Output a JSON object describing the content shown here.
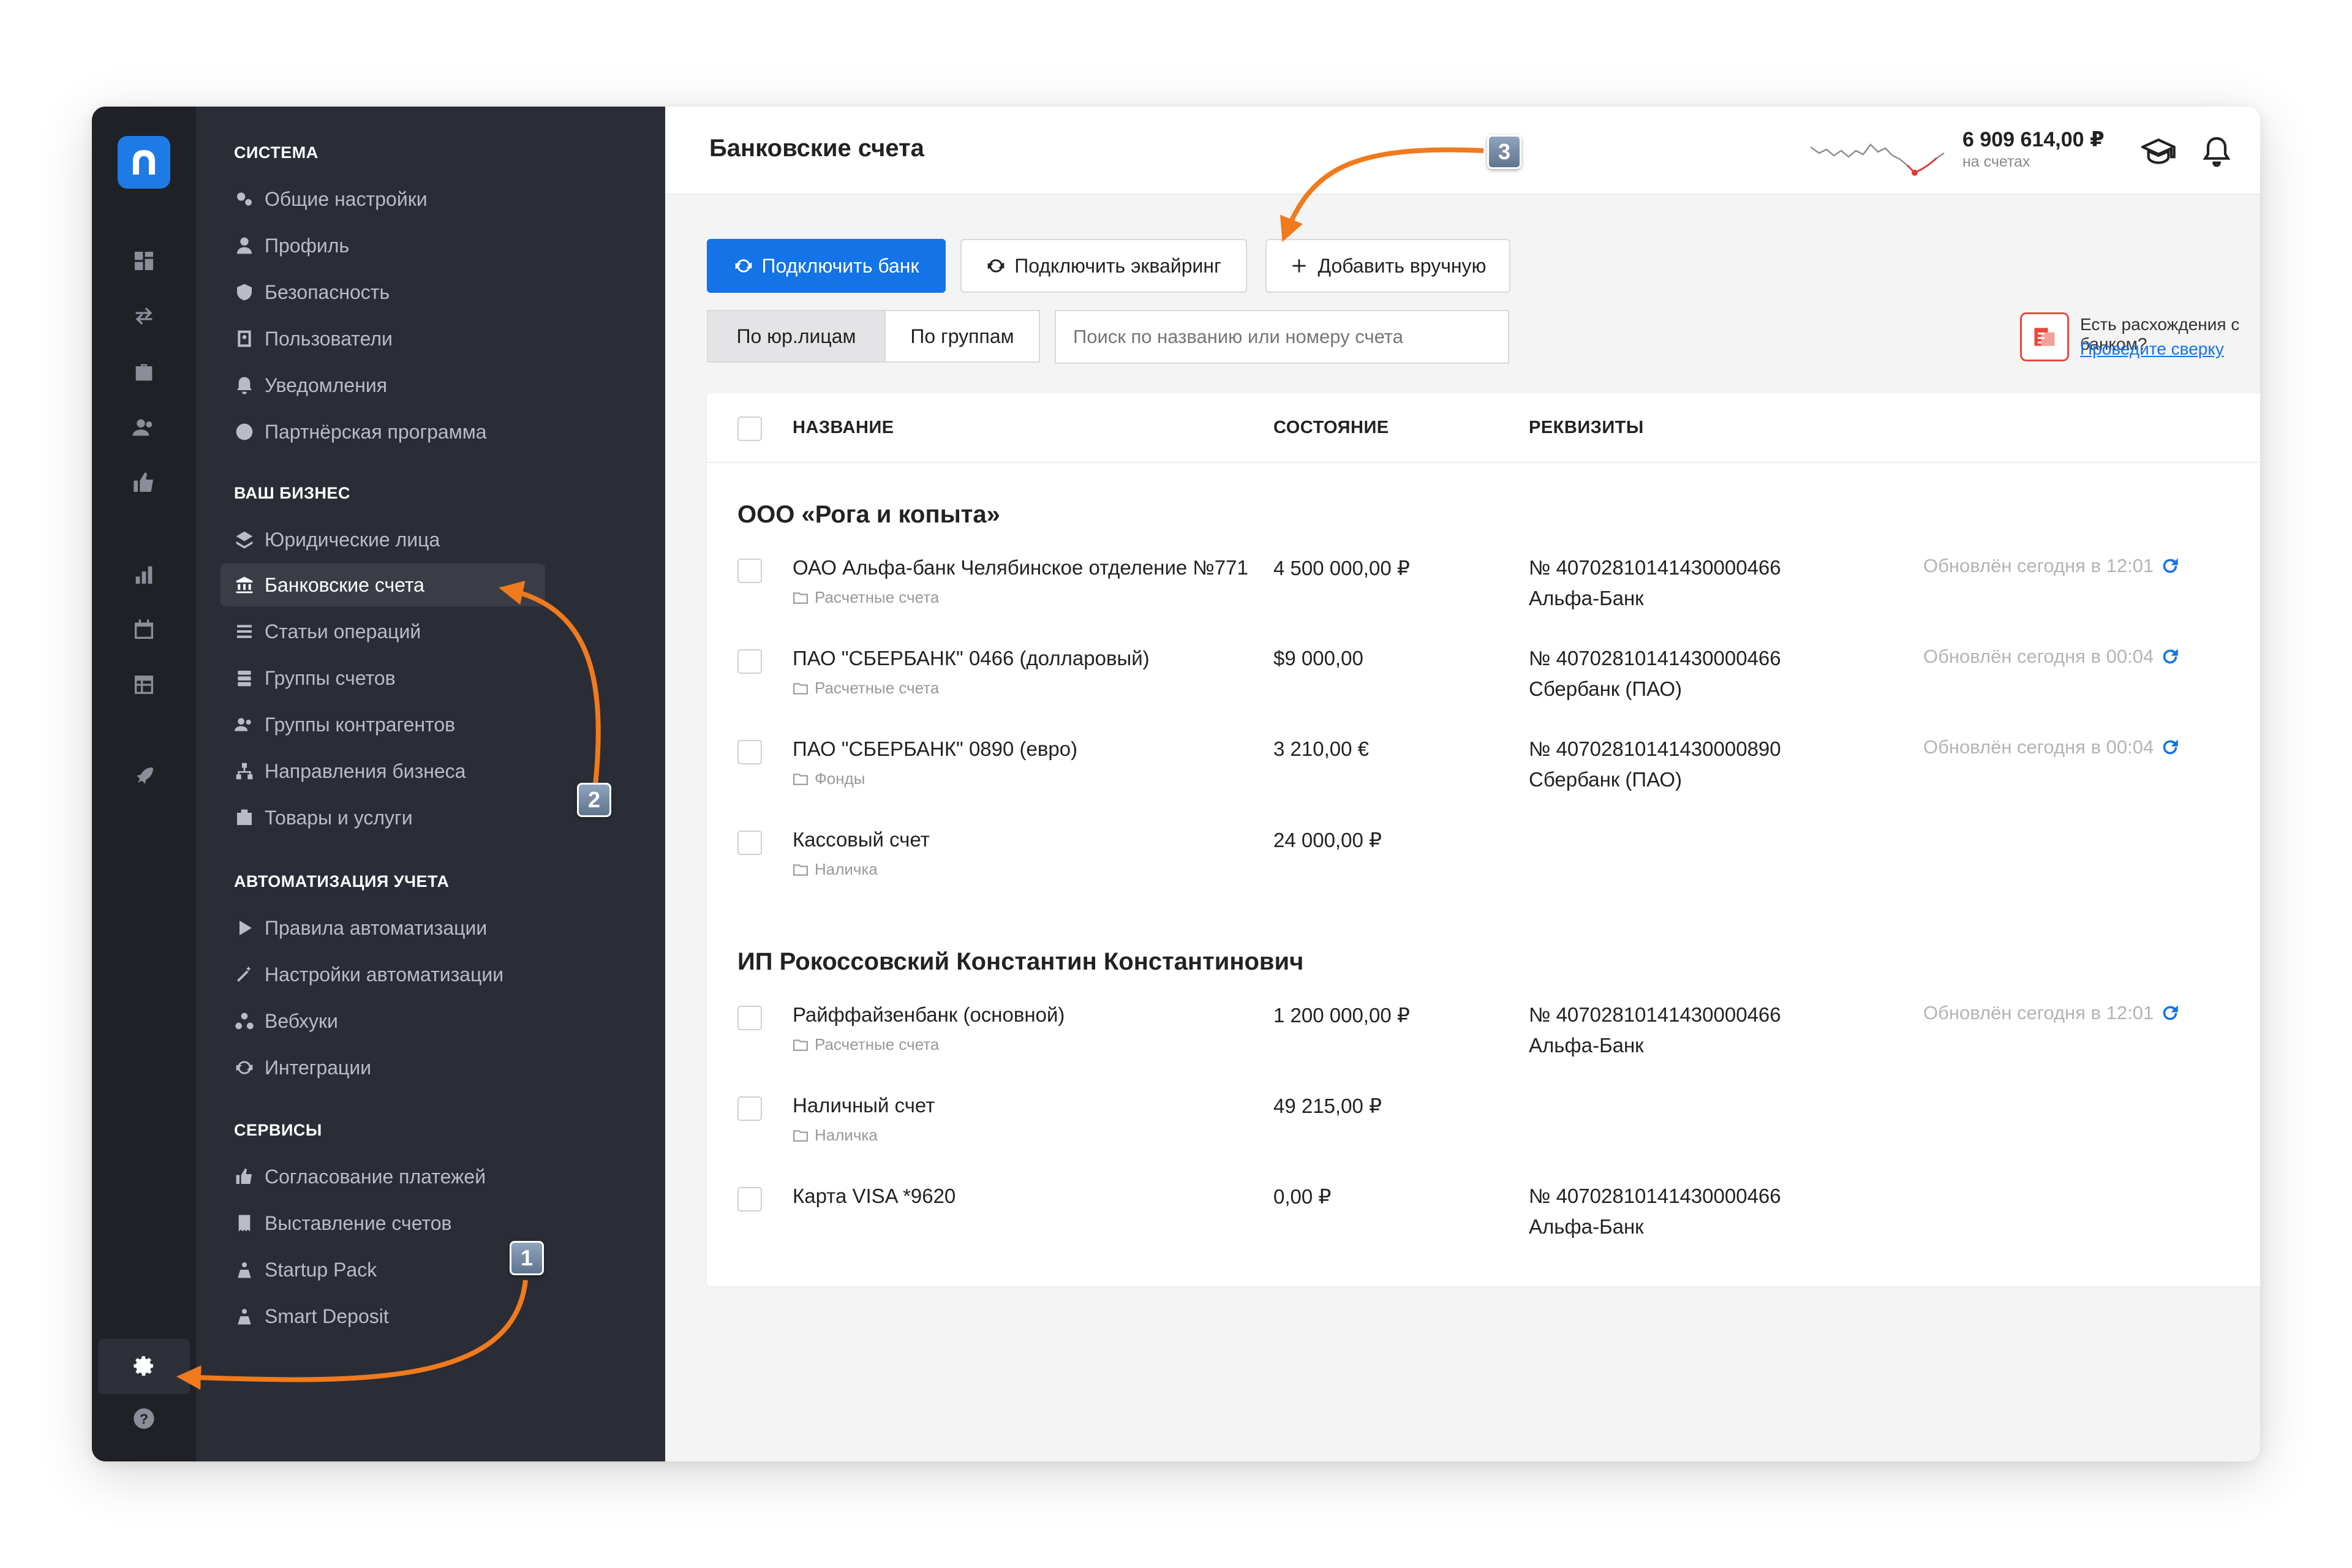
{
  "colors": {
    "accent": "#1473e6",
    "arrow": "#f07a1e",
    "sidebar_bg": "#2a2d35",
    "rail_bg": "#1f2127"
  },
  "sidebar": {
    "sections": [
      {
        "title": "СИСТЕМА",
        "items": [
          {
            "label": "Общие настройки",
            "icon": "gears-icon"
          },
          {
            "label": "Профиль",
            "icon": "user-icon"
          },
          {
            "label": "Безопасность",
            "icon": "shield-icon"
          },
          {
            "label": "Пользователи",
            "icon": "users-book-icon"
          },
          {
            "label": "Уведомления",
            "icon": "bell-icon"
          },
          {
            "label": "Партнёрская программа",
            "icon": "coin-icon"
          }
        ]
      },
      {
        "title": "ВАШ БИЗНЕС",
        "items": [
          {
            "label": "Юридические лица",
            "icon": "layers-icon"
          },
          {
            "label": "Банковские счета",
            "icon": "bank-icon",
            "active": true
          },
          {
            "label": "Статьи операций",
            "icon": "list-icon"
          },
          {
            "label": "Группы счетов",
            "icon": "stack-icon"
          },
          {
            "label": "Группы контрагентов",
            "icon": "people-icon"
          },
          {
            "label": "Направления бизнеса",
            "icon": "hierarchy-icon"
          },
          {
            "label": "Товары и услуги",
            "icon": "box-icon"
          }
        ]
      },
      {
        "title": "АВТОМАТИЗАЦИЯ УЧЕТА",
        "items": [
          {
            "label": "Правила автоматизации",
            "icon": "play-icon"
          },
          {
            "label": "Настройки автоматизации",
            "icon": "magic-wand-icon"
          },
          {
            "label": "Вебхуки",
            "icon": "webhook-icon"
          },
          {
            "label": "Интеграции",
            "icon": "sync-icon"
          }
        ]
      },
      {
        "title": "СЕРВИСЫ",
        "items": [
          {
            "label": "Согласование платежей",
            "icon": "thumbs-up-icon"
          },
          {
            "label": "Выставление счетов",
            "icon": "invoice-icon"
          },
          {
            "label": "Startup Pack",
            "icon": "startup-icon"
          },
          {
            "label": "Smart Deposit",
            "icon": "deposit-icon"
          }
        ]
      }
    ]
  },
  "header": {
    "title": "Банковские счета",
    "balance": "6 909 614,00 ₽",
    "balance_sub": "на счетах"
  },
  "toolbar": {
    "connect_bank": "Подключить банк",
    "connect_acquiring": "Подключить эквайринг",
    "add_manual": "Добавить вручную",
    "seg_legal": "По юр.лицам",
    "seg_groups": "По группам",
    "search_placeholder": "Поиск по названию или номеру счета",
    "recon_question": "Есть расхождения с банком?",
    "recon_link": "Проведите сверку"
  },
  "table": {
    "columns": [
      "НАЗВАНИЕ",
      "СОСТОЯНИЕ",
      "РЕКВИЗИТЫ"
    ],
    "groups": [
      {
        "title": "ООО «Рога и копыта»",
        "rows": [
          {
            "name": "ОАО Альфа-банк Челябинское отделение №771",
            "category": "Расчетные счета",
            "balance": "4 500 000,00 ₽",
            "req1": "№ 40702810141430000466",
            "req2": "Альфа-Банк",
            "updated": "Обновлён сегодня в 12:01"
          },
          {
            "name": "ПАО \"СБЕРБАНК\" 0466 (долларовый)",
            "category": "Расчетные счета",
            "balance": "$9 000,00",
            "req1": "№ 40702810141430000466",
            "req2": "Сбербанк (ПАО)",
            "updated": "Обновлён сегодня в 00:04"
          },
          {
            "name": "ПАО \"СБЕРБАНК\" 0890 (евро)",
            "category": "Фонды",
            "balance": "3 210,00 €",
            "req1": "№ 40702810141430000890",
            "req2": "Сбербанк (ПАО)",
            "updated": "Обновлён сегодня в 00:04"
          },
          {
            "name": "Кассовый счет",
            "category": "Наличка",
            "balance": "24 000,00 ₽",
            "req1": "",
            "req2": "",
            "updated": ""
          }
        ]
      },
      {
        "title": "ИП Рокоссовский Константин Константинович",
        "rows": [
          {
            "name": "Райффайзенбанк (основной)",
            "category": "Расчетные счета",
            "balance": "1 200 000,00 ₽",
            "req1": "№ 40702810141430000466",
            "req2": "Альфа-Банк",
            "updated": "Обновлён сегодня в 12:01"
          },
          {
            "name": "Наличный счет",
            "category": "Наличка",
            "balance": "49 215,00 ₽",
            "req1": "",
            "req2": "",
            "updated": ""
          },
          {
            "name": "Карта VISA *9620",
            "category": "",
            "balance": "0,00 ₽",
            "req1": "№ 40702810141430000466",
            "req2": "Альфа-Банк",
            "updated": ""
          }
        ]
      }
    ]
  },
  "annotations": {
    "badge_1": "1",
    "badge_2": "2",
    "badge_3": "3"
  }
}
